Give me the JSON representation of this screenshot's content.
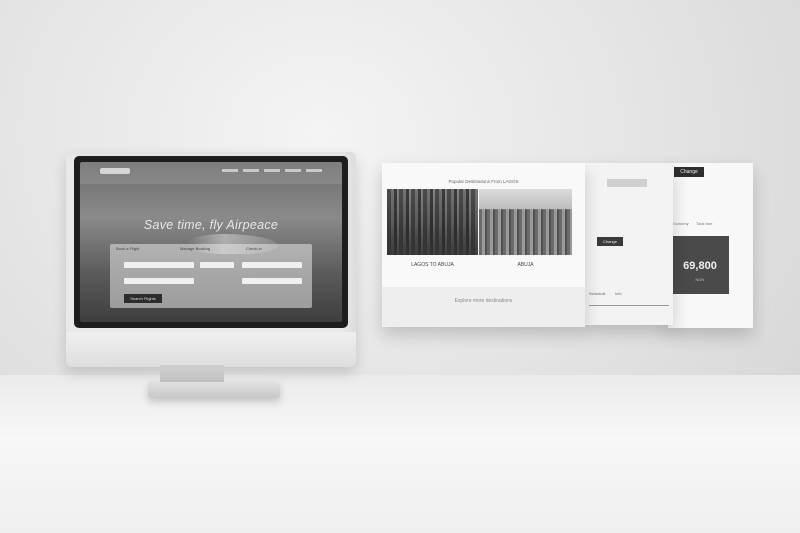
{
  "hero": {
    "title": "Save time, fly Airpeace",
    "booking_button": "Search Flights",
    "tabs": [
      "Book a Flight",
      "Manage Booking",
      "Check-in"
    ]
  },
  "panel_destinations": {
    "header": "Popular Destinations From LAGOS",
    "cities": [
      "LAGOS TO ABUJA",
      "ABUJA"
    ],
    "footer": "Explore more destinations"
  },
  "panel_schedule": {
    "button": "Change",
    "labels": [
      "Schedule",
      "Info"
    ]
  },
  "panel_fare": {
    "change_button": "Change",
    "price": "69,800",
    "price_sub": "NGN",
    "labels": [
      "Economy",
      "Total fare"
    ]
  }
}
